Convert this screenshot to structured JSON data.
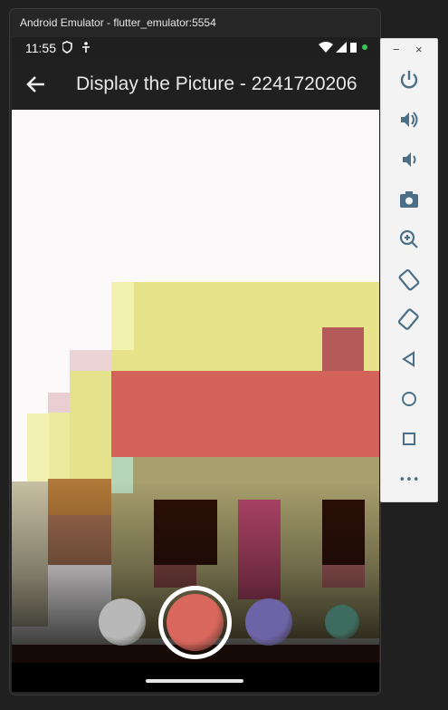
{
  "window": {
    "title": "Android Emulator - flutter_emulator:5554"
  },
  "status_bar": {
    "time": "11:55"
  },
  "app_bar": {
    "title": "Display the Picture - 2241720206"
  },
  "filters": {
    "colors": [
      "#b8b8b8",
      "#d9675d",
      "#6d64a8",
      "#3e6b5f"
    ],
    "selected_index": 1
  },
  "toolbar": {
    "minimize_label": "−",
    "close_label": "×",
    "more_label": "•••",
    "buttons": [
      "power-icon",
      "volume-up-icon",
      "volume-down-icon",
      "camera-icon",
      "zoom-icon",
      "rotate-left-icon",
      "rotate-right-icon",
      "back-icon",
      "home-icon",
      "overview-icon",
      "more-icon"
    ]
  }
}
